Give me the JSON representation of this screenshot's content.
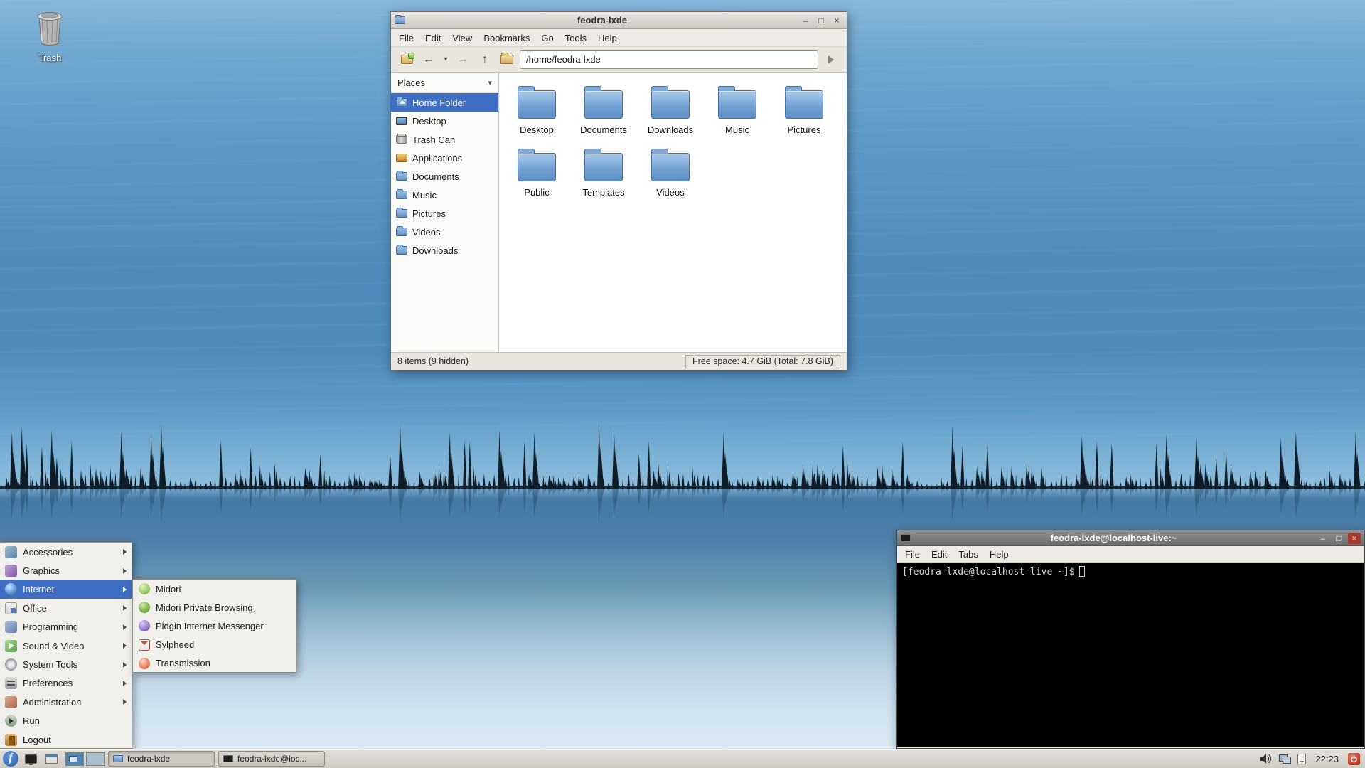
{
  "desktop": {
    "trash_label": "Trash"
  },
  "window_controls": {
    "minimize": "–",
    "maximize": "□",
    "close": "×"
  },
  "icons": {
    "back": "←",
    "forward": "→",
    "up": "↑",
    "history_chevron": "▾",
    "places_chevron": "▾",
    "fedora": "f",
    "volume": "speaker-icon",
    "network": "network-icon",
    "clipboard": "clipboard-icon",
    "power": "power-icon"
  },
  "file_manager": {
    "title": "feodra-lxde",
    "menu_items": [
      "File",
      "Edit",
      "View",
      "Bookmarks",
      "Go",
      "Tools",
      "Help"
    ],
    "path_value": "/home/feodra-lxde",
    "places_label": "Places",
    "sidebar_items": [
      "Home Folder",
      "Desktop",
      "Trash Can",
      "Applications",
      "Documents",
      "Music",
      "Pictures",
      "Videos",
      "Downloads"
    ],
    "folders": [
      "Desktop",
      "Documents",
      "Downloads",
      "Music",
      "Pictures",
      "Public",
      "Templates",
      "Videos"
    ],
    "status_left": "8 items (9 hidden)",
    "status_right": "Free space: 4.7 GiB (Total: 7.8 GiB)"
  },
  "terminal": {
    "title": "feodra-lxde@localhost-live:~",
    "menu_items": [
      "File",
      "Edit",
      "Tabs",
      "Help"
    ],
    "prompt": "[feodra-lxde@localhost-live ~]$"
  },
  "start_menu": {
    "items": [
      "Accessories",
      "Graphics",
      "Internet",
      "Office",
      "Programming",
      "Sound & Video",
      "System Tools",
      "Preferences",
      "Administration",
      "Run",
      "Logout"
    ],
    "highlighted_item": "Internet"
  },
  "internet_submenu": {
    "items": [
      "Midori",
      "Midori Private Browsing",
      "Pidgin Internet Messenger",
      "Sylpheed",
      "Transmission"
    ]
  },
  "taskbar": {
    "tasks": [
      {
        "label": "feodra-lxde",
        "active": true
      },
      {
        "label": "feodra-lxde@loc...",
        "active": false
      }
    ],
    "clock": "22:23"
  },
  "colors": {
    "selection_blue": "#3e6fc4",
    "folder_blue": "#6f9fd2",
    "taskbar_bg": "#d5d1cb",
    "terminal_bg": "#000000"
  }
}
